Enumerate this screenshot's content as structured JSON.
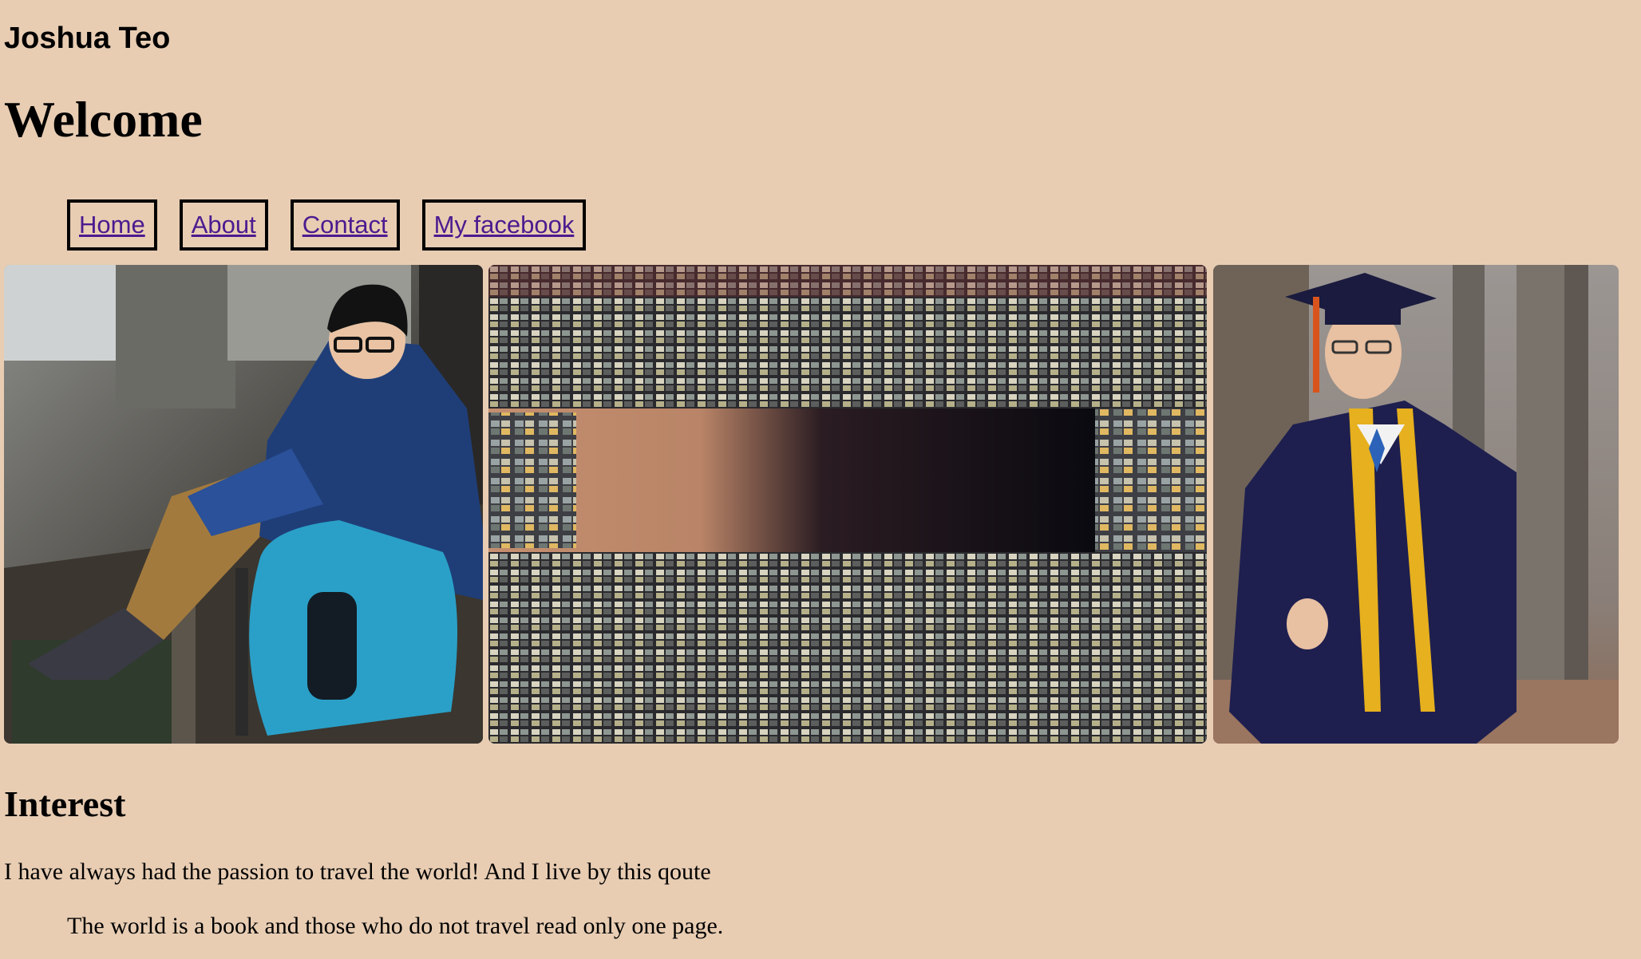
{
  "header": {
    "site_name": "Joshua Teo",
    "title": "Welcome"
  },
  "nav": {
    "items": [
      {
        "label": "Home"
      },
      {
        "label": "About"
      },
      {
        "label": "Contact"
      },
      {
        "label": "My facebook"
      }
    ]
  },
  "gallery": {
    "images": [
      {
        "icon": "traveler-photo"
      },
      {
        "icon": "city-buildings-photo"
      },
      {
        "icon": "graduation-photo"
      }
    ]
  },
  "interest": {
    "heading": "Interest",
    "paragraph": "I have always had the passion to travel the world! And I live by this qoute",
    "quote": "The world is a book and those who do not travel read only one page."
  },
  "colors": {
    "background": "#e8cdb3",
    "link": "#4b1b8f"
  }
}
